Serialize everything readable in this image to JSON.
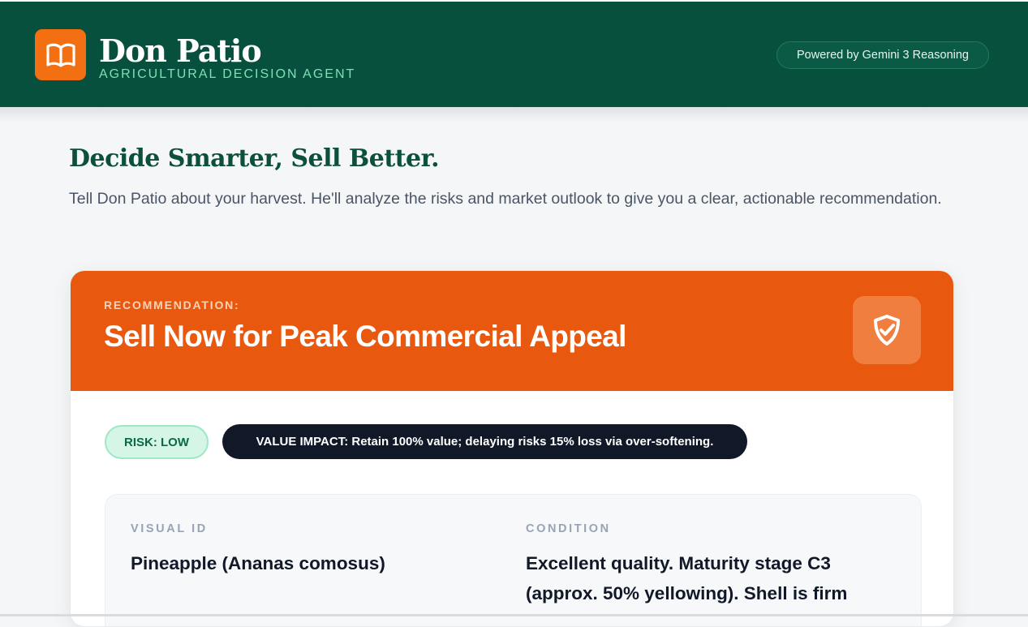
{
  "header": {
    "brand_name": "Don Patio",
    "brand_subtitle": "AGRICULTURAL DECISION AGENT",
    "powered_badge": "Powered by Gemini 3 Reasoning",
    "logo_icon": "open-book-icon",
    "brand_color": "#07503d",
    "logo_color": "#f26f12"
  },
  "hero": {
    "title": "Decide Smarter, Sell Better.",
    "description": "Tell Don Patio about your harvest. He'll analyze the risks and market outlook to give you a clear, actionable recommendation."
  },
  "recommendation": {
    "label": "RECOMMENDATION:",
    "title": "Sell Now for Peak Commercial Appeal",
    "icon": "shield-check-icon",
    "accent_color": "#e8580e",
    "risk_badge": "RISK: LOW",
    "value_impact": "VALUE IMPACT: Retain 100% value; delaying risks 15% loss via over-softening.",
    "details": {
      "visual_id_label": "VISUAL ID",
      "visual_id_value": "Pineapple (Ananas comosus)",
      "condition_label": "CONDITION",
      "condition_value": "Excellent quality. Maturity stage C3 (approx. 50% yellowing). Shell is firm"
    }
  }
}
